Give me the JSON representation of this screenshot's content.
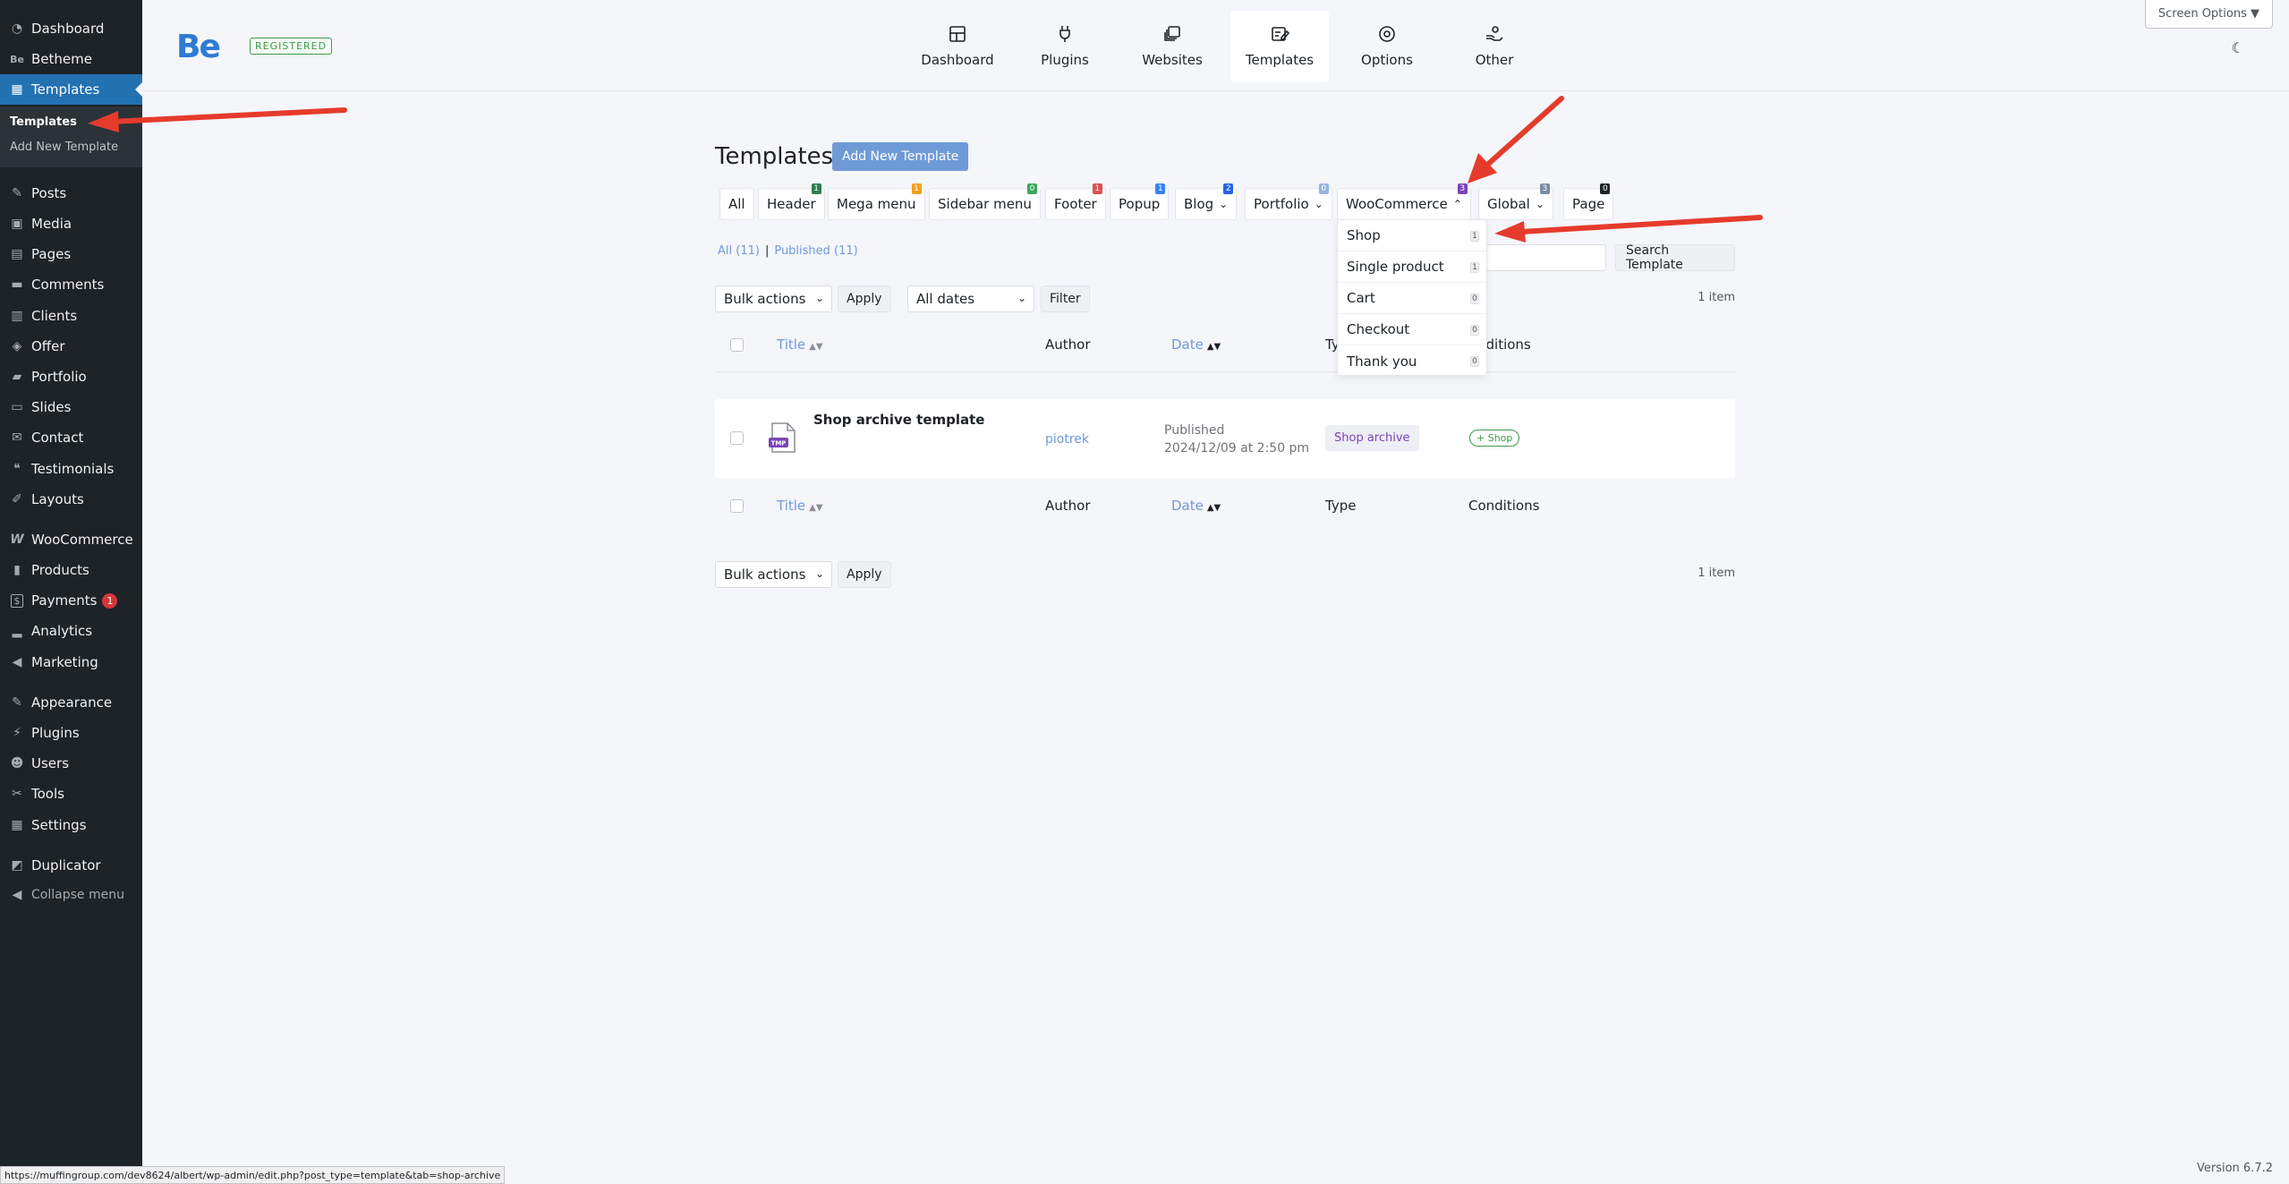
{
  "sidebar": {
    "items": [
      {
        "label": "Dashboard",
        "icon": "dashboard-icon",
        "glyph": "◔"
      },
      {
        "label": "Betheme",
        "icon": "betheme-icon",
        "glyph": "Be"
      },
      {
        "label": "Templates",
        "icon": "templates-icon",
        "glyph": "▦"
      },
      {
        "label": "Posts",
        "icon": "pin-icon",
        "glyph": "✎"
      },
      {
        "label": "Media",
        "icon": "media-icon",
        "glyph": "▣"
      },
      {
        "label": "Pages",
        "icon": "pages-icon",
        "glyph": "▤"
      },
      {
        "label": "Comments",
        "icon": "comments-icon",
        "glyph": "▬"
      },
      {
        "label": "Clients",
        "icon": "clients-icon",
        "glyph": "▥"
      },
      {
        "label": "Offer",
        "icon": "tag-icon",
        "glyph": "◈"
      },
      {
        "label": "Portfolio",
        "icon": "portfolio-icon",
        "glyph": "▰"
      },
      {
        "label": "Slides",
        "icon": "slides-icon",
        "glyph": "▭"
      },
      {
        "label": "Contact",
        "icon": "email-icon",
        "glyph": "✉"
      },
      {
        "label": "Testimonials",
        "icon": "quote-icon",
        "glyph": "❝"
      },
      {
        "label": "Layouts",
        "icon": "layouts-icon",
        "glyph": "✐"
      },
      {
        "label": "WooCommerce",
        "icon": "woocommerce-icon",
        "glyph": "W"
      },
      {
        "label": "Products",
        "icon": "products-icon",
        "glyph": "▮"
      },
      {
        "label": "Payments",
        "icon": "payments-icon",
        "glyph": "$",
        "badge": "1"
      },
      {
        "label": "Analytics",
        "icon": "analytics-icon",
        "glyph": "▂"
      },
      {
        "label": "Marketing",
        "icon": "megaphone-icon",
        "glyph": "◀"
      },
      {
        "label": "Appearance",
        "icon": "brush-icon",
        "glyph": "✎"
      },
      {
        "label": "Plugins",
        "icon": "plugin-icon",
        "glyph": "⚡"
      },
      {
        "label": "Users",
        "icon": "users-icon",
        "glyph": "☻"
      },
      {
        "label": "Tools",
        "icon": "wrench-icon",
        "glyph": "✂"
      },
      {
        "label": "Settings",
        "icon": "settings-icon",
        "glyph": "▦"
      },
      {
        "label": "Duplicator",
        "icon": "duplicator-icon",
        "glyph": "◩"
      }
    ],
    "submenu": [
      "Templates",
      "Add New Template"
    ],
    "collapse_label": "Collapse menu"
  },
  "topbar": {
    "logo": "Be",
    "registered": "REGISTERED",
    "nav": [
      {
        "label": "Dashboard",
        "icon": "dashboard-grid-icon"
      },
      {
        "label": "Plugins",
        "icon": "plug-icon"
      },
      {
        "label": "Websites",
        "icon": "websites-icon"
      },
      {
        "label": "Templates",
        "icon": "template-edit-icon"
      },
      {
        "label": "Options",
        "icon": "gear-icon"
      },
      {
        "label": "Other",
        "icon": "hand-icon"
      }
    ],
    "screen_options": "Screen Options ▼",
    "moon": "☾"
  },
  "main": {
    "title": "Templates",
    "add_new": "Add New Template",
    "filters": [
      {
        "label": "All",
        "count": ""
      },
      {
        "label": "Header",
        "count": "1",
        "color": "#2e7d4f"
      },
      {
        "label": "Mega menu",
        "count": "1",
        "color": "#f0a020"
      },
      {
        "label": "Sidebar menu",
        "count": "0",
        "color": "#3aa85b"
      },
      {
        "label": "Footer",
        "count": "1",
        "color": "#d9534f"
      },
      {
        "label": "Popup",
        "count": "1",
        "color": "#3b82f6"
      },
      {
        "label": "Blog",
        "count": "2",
        "color": "#2563eb",
        "caret": true
      },
      {
        "label": "Portfolio",
        "count": "0",
        "color": "#93b4e0",
        "caret": true
      },
      {
        "label": "WooCommerce",
        "count": "3",
        "color": "#7a44b8",
        "caret": true,
        "caret_up": true
      },
      {
        "label": "Global",
        "count": "3",
        "color": "#7a8ba6",
        "caret": true
      },
      {
        "label": "Page",
        "count": "0",
        "color": "#1d2327"
      }
    ],
    "views": {
      "all": "All (11)",
      "sep": "|",
      "published": "Published (11)"
    },
    "search_btn": "Search Template",
    "bulk_actions": "Bulk actions",
    "apply": "Apply",
    "all_dates": "All dates",
    "filter": "Filter",
    "items_count": "1 item",
    "columns": {
      "title": "Title",
      "author": "Author",
      "date": "Date",
      "type": "Type",
      "conditions": "Conditions"
    },
    "header_type_partial": "Ty",
    "header_cond_partial": "nditions",
    "row": {
      "icon_label": "TMP",
      "title": "Shop archive template",
      "author": "piotrek",
      "status": "Published",
      "date": "2024/12/09 at 2:50 pm",
      "type": "Shop archive",
      "condition": "+ Shop"
    },
    "dropdown": [
      {
        "label": "Shop",
        "count": "1"
      },
      {
        "label": "Single product",
        "count": "1"
      },
      {
        "label": "Cart",
        "count": "0"
      },
      {
        "label": "Checkout",
        "count": "0"
      },
      {
        "label": "Thank you",
        "count": "0"
      }
    ]
  },
  "footer": {
    "status_url": "https://muffingroup.com/dev8624/albert/wp-admin/edit.php?post_type=template&tab=shop-archive",
    "version": "Version 6.7.2"
  },
  "colors": {
    "accent": "#2271b1",
    "brand": "#2f7bd3",
    "arrow": "#e53b2c"
  }
}
